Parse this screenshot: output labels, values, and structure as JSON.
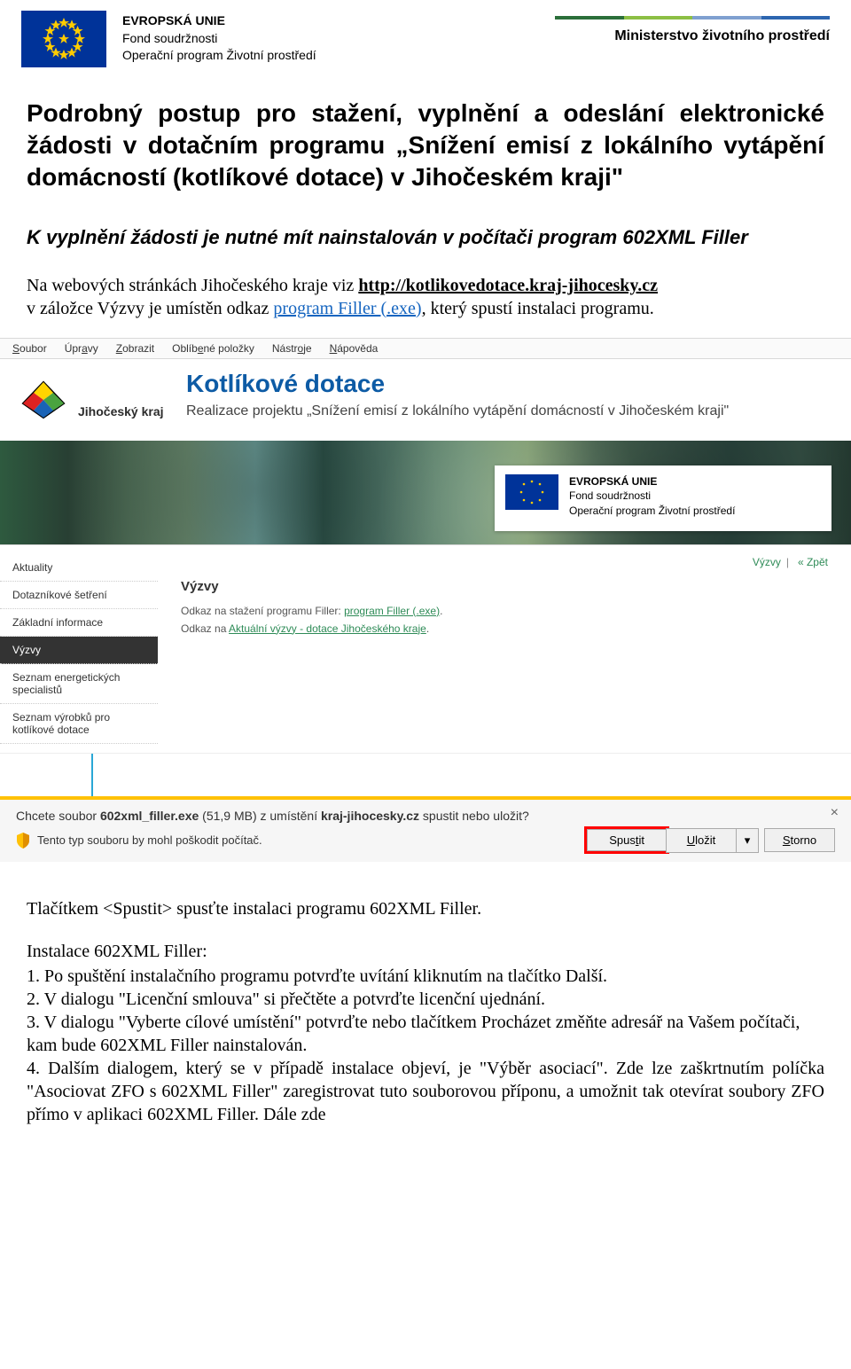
{
  "header": {
    "eu_line1": "EVROPSKÁ UNIE",
    "eu_line2": "Fond soudržnosti",
    "eu_line3": "Operační program Životní prostředí",
    "mzp": "Ministerstvo životního prostředí"
  },
  "doc": {
    "title": "Podrobný postup pro stažení, vyplnění a odeslání elektronické žádosti v dotačním programu „Snížení emisí z lokálního vytápění domácností (kotlíkové dotace) v Jihočeském kraji\"",
    "subtitle": "K vyplnění žádosti je nutné mít nainstalován v počítači program 602XML Filler",
    "para_pre": "Na webových stránkách Jihočeského kraje viz ",
    "para_link": "http://kotlikovedotace.kraj-jihocesky.cz",
    "para_line2a": "v záložce Výzvy je umístěn odkaz ",
    "para_inline": "program Filler (.exe)",
    "para_line2b": ", který spustí instalaci programu."
  },
  "menubar": {
    "items": [
      "Soubor",
      "Úpravy",
      "Zobrazit",
      "Oblíbené položky",
      "Nástroje",
      "Nápověda"
    ]
  },
  "hero": {
    "kraj": "Jihočeský kraj",
    "title": "Kotlíkové dotace",
    "subtitle": "Realizace projektu „Snížení emisí z lokálního vytápění domácností v Jihočeském kraji\"",
    "eu_box": {
      "l1": "EVROPSKÁ UNIE",
      "l2": "Fond soudržnosti",
      "l3": "Operační program Životní prostředí"
    }
  },
  "sidebar": {
    "items": [
      "Aktuality",
      "Dotazníkové šetření",
      "Základní informace",
      "Výzvy",
      "Seznam energetických specialistů",
      "Seznam výrobků pro kotlíkové dotace"
    ]
  },
  "strip": {
    "breadcrumb_a": "Výzvy",
    "breadcrumb_b": "« Zpět",
    "heading": "Výzvy",
    "line1_pre": "Odkaz na stažení programu Filler: ",
    "line1_link": "program Filler (.exe)",
    "line1_post": ".",
    "line2_pre": "Odkaz na ",
    "line2_link": "Aktuální výzvy - dotace Jihočeského kraje",
    "line2_post": "."
  },
  "dlbar": {
    "line1_pre": "Chcete soubor ",
    "file": "602xml_filler.exe",
    "size": " (51,9 MB) z umístění ",
    "host": "kraj-jihocesky.cz",
    "line1_post": " spustit nebo uložit?",
    "line2": "Tento typ souboru by mohl poškodit počítač.",
    "run": "Spustit",
    "save": "Uložit",
    "cancel": "Storno"
  },
  "lower": {
    "p1": "Tlačítkem <Spustit>  spusťte instalaci programu 602XML Filler.",
    "h": "Instalace 602XML Filler:",
    "s1": "1. Po spuštění instalačního programu potvrďte uvítání kliknutím na tlačítko Další.",
    "s2": "2. V dialogu \"Licenční smlouva\" si přečtěte a potvrďte licenční ujednání.",
    "s3": "3. V dialogu \"Vyberte cílové umístění\" potvrďte nebo tlačítkem Procházet změňte adresář na Vašem počítači, kam bude 602XML Filler nainstalován.",
    "s4": "4. Dalším dialogem, který se v případě instalace objeví, je \"Výběr asociací\". Zde lze zaškrtnutím políčka \"Asociovat ZFO s 602XML Filler\" zaregistrovat tuto souborovou příponu, a umožnit tak otevírat soubory ZFO přímo v aplikaci 602XML Filler. Dále zde"
  }
}
